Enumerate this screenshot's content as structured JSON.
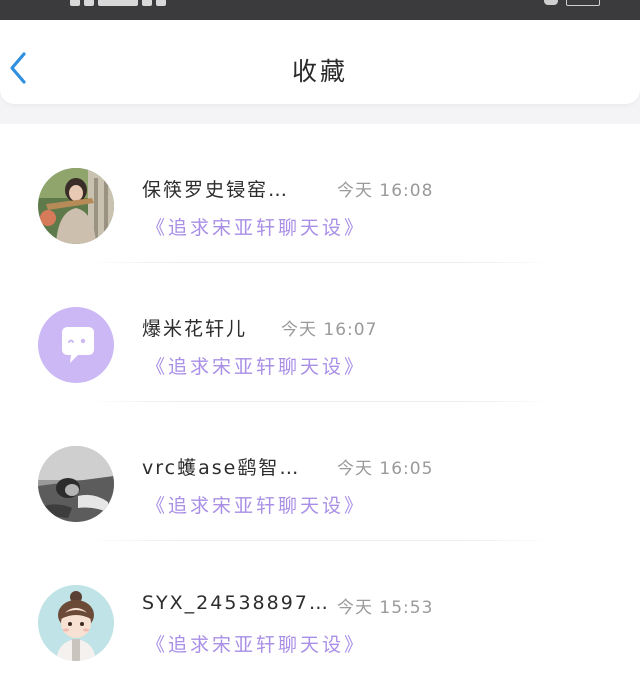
{
  "header": {
    "title": "收藏"
  },
  "favorites": [
    {
      "name": "保筷罗史锓窑…",
      "time": "今天 16:08",
      "subtitle": "《追求宋亚轩聊天设》",
      "avatar_icon": "avatar-photo-girl"
    },
    {
      "name": "爆米花轩儿",
      "time": "今天 16:07",
      "subtitle": "《追求宋亚轩聊天设》",
      "avatar_icon": "chat-bubble-icon"
    },
    {
      "name": "vrc蠖ase鹞智…",
      "time": "今天 16:05",
      "subtitle": "《追求宋亚轩聊天设》",
      "avatar_icon": "avatar-photo-grayscale"
    },
    {
      "name": "SYX_24538897…",
      "time": "今天 15:53",
      "subtitle": "《追求宋亚轩聊天设》",
      "avatar_icon": "avatar-cartoon-boy"
    }
  ],
  "colors": {
    "accent": "#a98fe6",
    "back_arrow": "#2f8fe0",
    "avatar_purple": "#cbb8f4"
  }
}
